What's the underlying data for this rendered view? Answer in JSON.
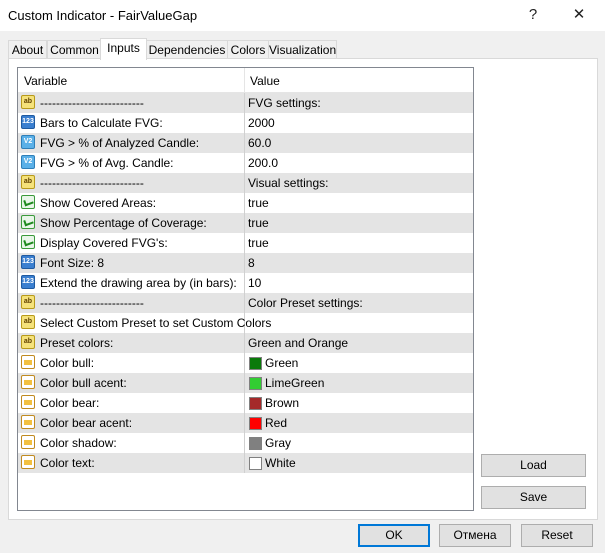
{
  "window": {
    "title": "Custom Indicator - FairValueGap",
    "help_glyph": "?",
    "close_glyph": "✕"
  },
  "tabs": [
    {
      "label": "About"
    },
    {
      "label": "Common"
    },
    {
      "label": "Inputs",
      "active": true
    },
    {
      "label": "Dependencies"
    },
    {
      "label": "Colors"
    },
    {
      "label": "Visualization"
    }
  ],
  "table": {
    "headers": {
      "variable": "Variable",
      "value": "Value"
    },
    "rows": [
      {
        "icon": "ab-icon",
        "variable": "--------------------------",
        "value": ""
      },
      {
        "icon": "int-icon",
        "variable": "Bars to Calculate FVG:",
        "value": "2000"
      },
      {
        "icon": "double-icon",
        "variable": "FVG > % of Analyzed Candle:",
        "value": "60.0"
      },
      {
        "icon": "double-icon",
        "variable": "FVG > % of Avg. Candle:",
        "value": "200.0"
      },
      {
        "icon": "ab-icon",
        "variable": "--------------------------",
        "value": "Visual settings:"
      },
      {
        "icon": "bool-icon",
        "variable": "Show Covered Areas:",
        "value": "true"
      },
      {
        "icon": "bool-icon",
        "variable": "Show Percentage of Coverage:",
        "value": "true"
      },
      {
        "icon": "bool-icon",
        "variable": "Display Covered FVG's:",
        "value": "true"
      },
      {
        "icon": "int-icon",
        "variable": "Font Size: 8",
        "value": "8"
      },
      {
        "icon": "int-icon",
        "variable": "Extend the drawing area by (in bars):",
        "value": "10"
      },
      {
        "icon": "ab-icon",
        "variable": "--------------------------",
        "value": "Color Preset settings:"
      },
      {
        "icon": "ab-icon",
        "variable": "Select Custom Preset to set Custom Colors",
        "value": ""
      },
      {
        "icon": "ab-icon",
        "variable": "Preset colors:",
        "value": "Green and Orange"
      },
      {
        "icon": "color-icon",
        "variable": "Color bull:",
        "value": "Green",
        "swatch": "#0a7a0a"
      },
      {
        "icon": "color-icon",
        "variable": "Color bull acent:",
        "value": "LimeGreen",
        "swatch": "#32cd32"
      },
      {
        "icon": "color-icon",
        "variable": "Color bear:",
        "value": "Brown",
        "swatch": "#a52a2a"
      },
      {
        "icon": "color-icon",
        "variable": "Color bear acent:",
        "value": "Red",
        "swatch": "#ff0000"
      },
      {
        "icon": "color-icon",
        "variable": "Color shadow:",
        "value": "Gray",
        "swatch": "#808080"
      },
      {
        "icon": "color-icon",
        "variable": "Color text:",
        "value": "White",
        "swatch": "#ffffff"
      }
    ],
    "row0_value": "FVG settings:"
  },
  "buttons": {
    "load": "Load",
    "save": "Save",
    "ok": "OK",
    "cancel": "Отмена",
    "reset": "Reset"
  },
  "colors": {
    "accent": "#0078d7",
    "row_alt": "#e4e4e4"
  }
}
